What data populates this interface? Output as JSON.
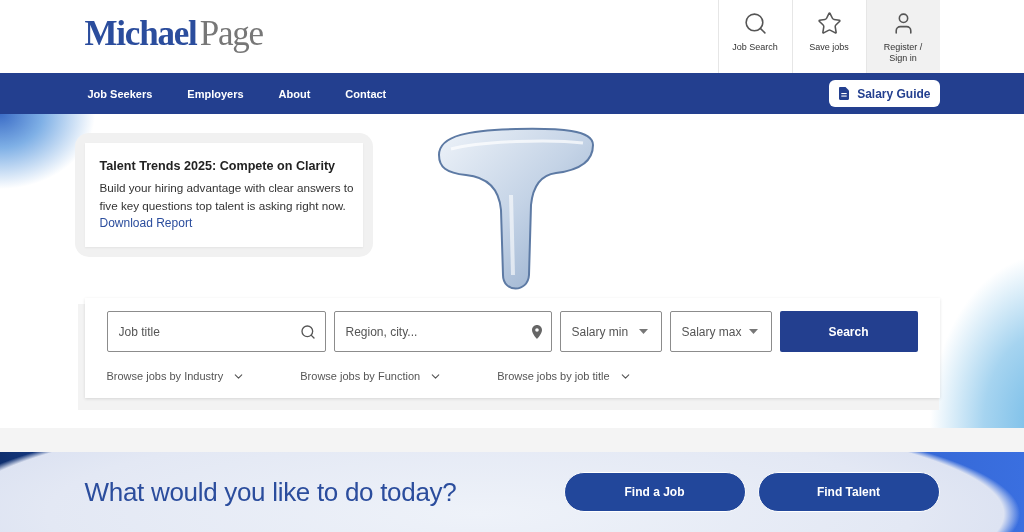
{
  "header": {
    "logo": {
      "first": "Michael",
      "second": "Page"
    },
    "actions": [
      {
        "kind": "search",
        "label": "Job Search",
        "highlighted": false
      },
      {
        "kind": "star",
        "label": "Save jobs",
        "highlighted": false
      },
      {
        "kind": "user",
        "label": "Register / Sign in",
        "highlighted": true
      }
    ]
  },
  "nav": {
    "items": [
      "Job Seekers",
      "Employers",
      "About",
      "Contact"
    ],
    "salary_guide": "Salary Guide"
  },
  "promo": {
    "title": "Talent Trends 2025: Compete on Clarity",
    "body": "Build your hiring advantage with clear answers to five key questions top talent is asking right now.",
    "link": "Download Report"
  },
  "search": {
    "fields": [
      {
        "kind": "keyword",
        "placeholder": "Job title"
      },
      {
        "kind": "location",
        "placeholder": "Region, city..."
      },
      {
        "kind": "select",
        "label": "Salary min"
      },
      {
        "kind": "select",
        "label": "Salary max"
      }
    ],
    "button": "Search",
    "browse": [
      "Browse jobs by Industry",
      "Browse jobs by Function",
      "Browse jobs by job title"
    ]
  },
  "cta": {
    "heading": "What would you like to do today?",
    "buttons": [
      "Find a Job",
      "Find Talent"
    ]
  }
}
